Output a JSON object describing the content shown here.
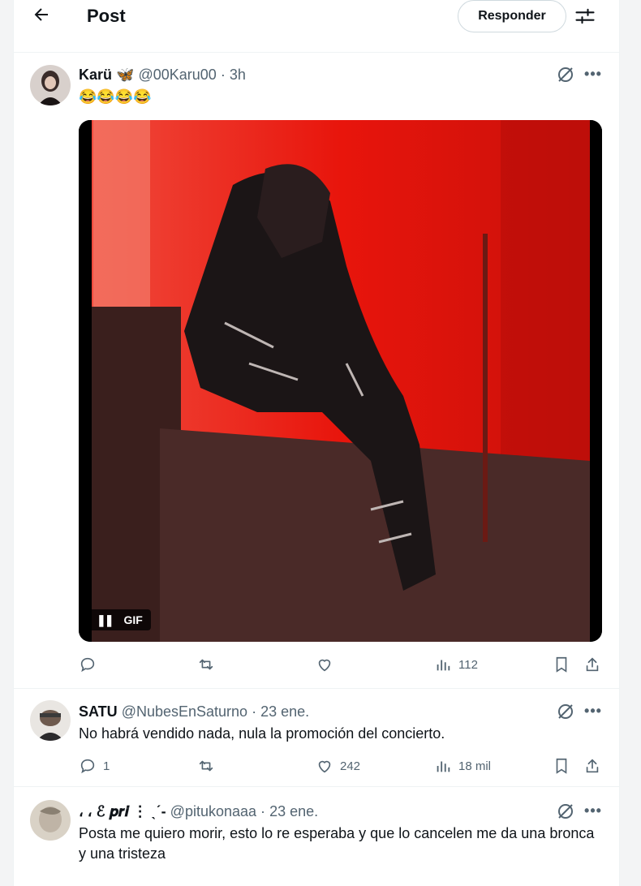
{
  "header": {
    "back_icon": "arrow-left-icon",
    "title": "Post",
    "reply_button": "Responder",
    "filter_icon": "sliders-icon"
  },
  "posts": [
    {
      "name": "Karü 🦋",
      "handle": "@00Karu00",
      "time": "3h",
      "text": "😂😂😂😂",
      "media": {
        "badge": "GIF",
        "type": "gif"
      },
      "stats": {
        "replies": "",
        "reposts": "",
        "likes": "",
        "views": "112"
      }
    },
    {
      "name": "SATU",
      "handle": "@NubesEnSaturno",
      "time": "23 ene.",
      "text": "No habrá vendido nada, nula la promoción del concierto.",
      "stats": {
        "replies": "1",
        "reposts": "",
        "likes": "242",
        "views": "18 mil"
      }
    },
    {
      "name": "، ، ℰ 𝒑𝒓𝒊 ⋮ ˎˊ-",
      "handle": "@pitukonaaa",
      "time": "23 ene.",
      "text": "Posta me quiero morir, esto lo re esperaba y que lo cancelen me da una bronca y una tristeza"
    }
  ],
  "separator": "·",
  "colors": {
    "text": "#0f1419",
    "secondary": "#536471",
    "border": "#eff3f4",
    "media_red": "#e3170f"
  }
}
